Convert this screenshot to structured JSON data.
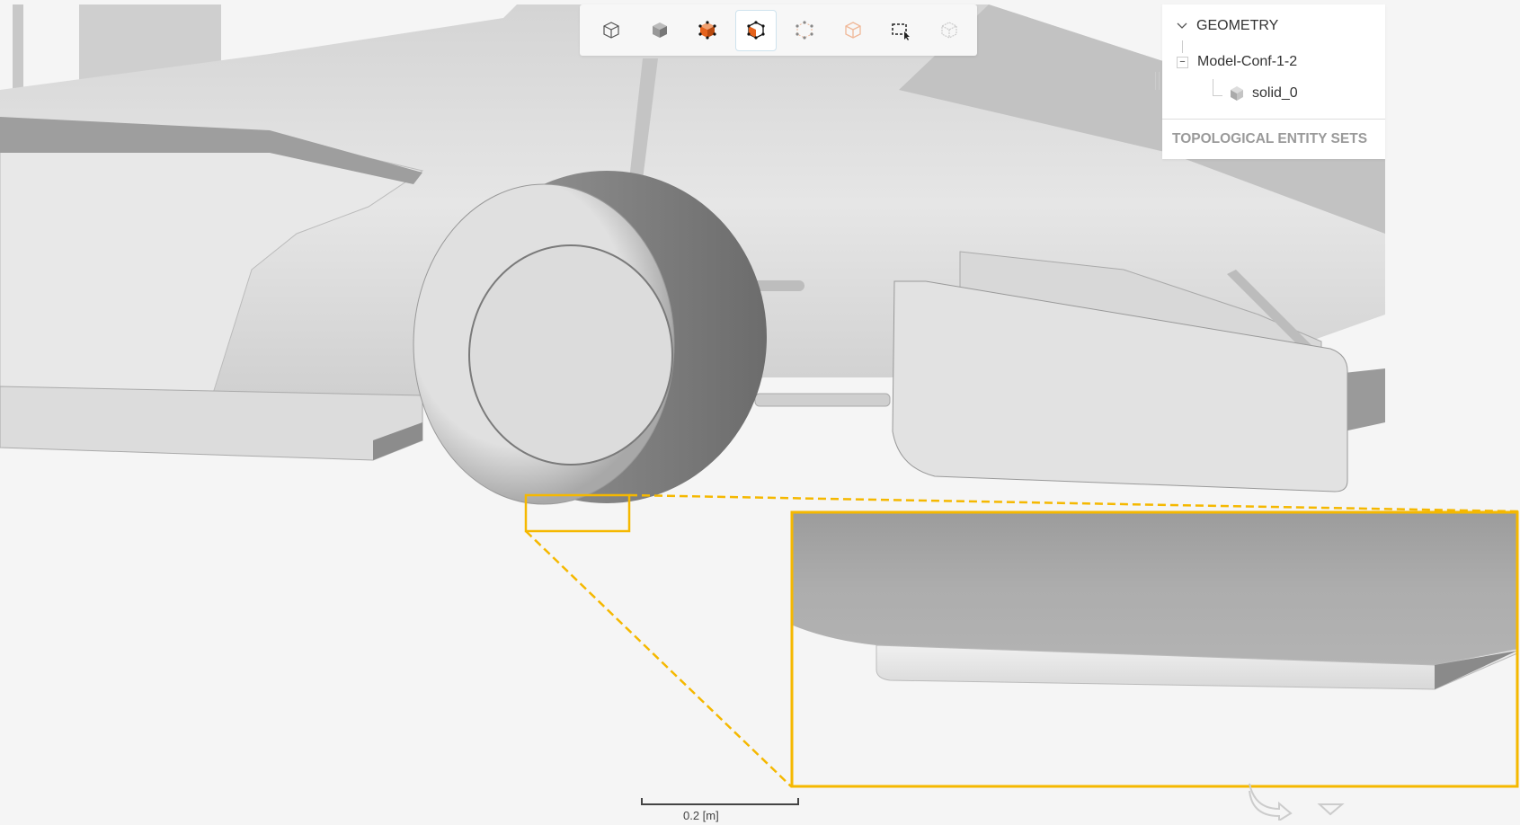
{
  "toolbar": {
    "buttons": [
      {
        "icon": "wireframe-cube-icon",
        "active": false
      },
      {
        "icon": "solid-cube-icon",
        "active": false
      },
      {
        "icon": "select-volume-icon",
        "active": false
      },
      {
        "icon": "select-face-icon",
        "active": true
      },
      {
        "icon": "select-vertex-icon",
        "active": false
      },
      {
        "icon": "select-edge-icon",
        "active": false
      },
      {
        "icon": "box-select-icon",
        "active": false
      },
      {
        "icon": "hidden-select-icon",
        "active": false
      }
    ],
    "accent": "#e4621c"
  },
  "geometry_panel": {
    "header": "GEOMETRY",
    "model": "Model-Conf-1-2",
    "solid": "solid_0",
    "topological_sets": "TOPOLOGICAL ENTITY SETS"
  },
  "scale_bar": {
    "label": "0.2 [m]"
  },
  "highlight_color": "#f5b800"
}
